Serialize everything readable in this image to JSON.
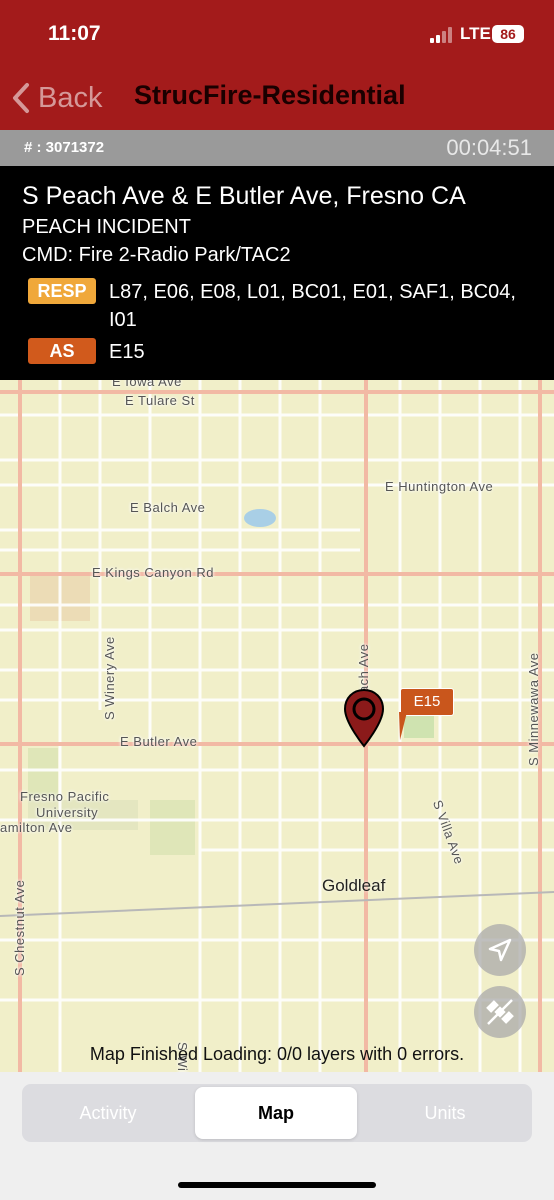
{
  "status_bar": {
    "time": "11:07",
    "network": "LTE",
    "battery": "86"
  },
  "nav": {
    "back_label": "Back",
    "title": "StrucFire-Residential"
  },
  "incident": {
    "number": "# : 3071372",
    "timer": "00:04:51",
    "address": "S Peach Ave & E Butler Ave, Fresno CA",
    "name": "PEACH INCIDENT",
    "command": "CMD: Fire 2-Radio Park/TAC2",
    "resp_badge": "RESP",
    "resp_units": "L87, E06, E08, L01, BC01, E01, SAF1, BC04, I01",
    "as_badge": "AS",
    "as_units": "E15"
  },
  "map": {
    "labels": {
      "iowa": "E Iowa Ave",
      "tulare": "E Tulare St",
      "huntington": "E Huntington Ave",
      "balch": "E Balch Ave",
      "kings_canyon": "E Kings Canyon Rd",
      "butler": "E Butler Ave",
      "fresno_pacific_1": "Fresno Pacific",
      "fresno_pacific_2": "University",
      "hamilton": "amilton Ave",
      "winery": "S Winery Ave",
      "peach": "Peach Ave",
      "villa": "S Villa Ave",
      "minnewawa": "S Minnewawa Ave",
      "chestnut": "S Chestnut Ave",
      "willow": "S Willow",
      "goldleaf": "Goldleaf"
    },
    "unit_tag": "E15",
    "status": "Map Finished Loading: 0/0 layers with 0 errors.",
    "colors": {
      "pin": "#8b1a1a",
      "unit_tag": "#c9561c",
      "major_road": "#f2b9a4"
    }
  },
  "tabs": [
    {
      "label": "Activity",
      "active": false
    },
    {
      "label": "Map",
      "active": true
    },
    {
      "label": "Units",
      "active": false
    }
  ]
}
